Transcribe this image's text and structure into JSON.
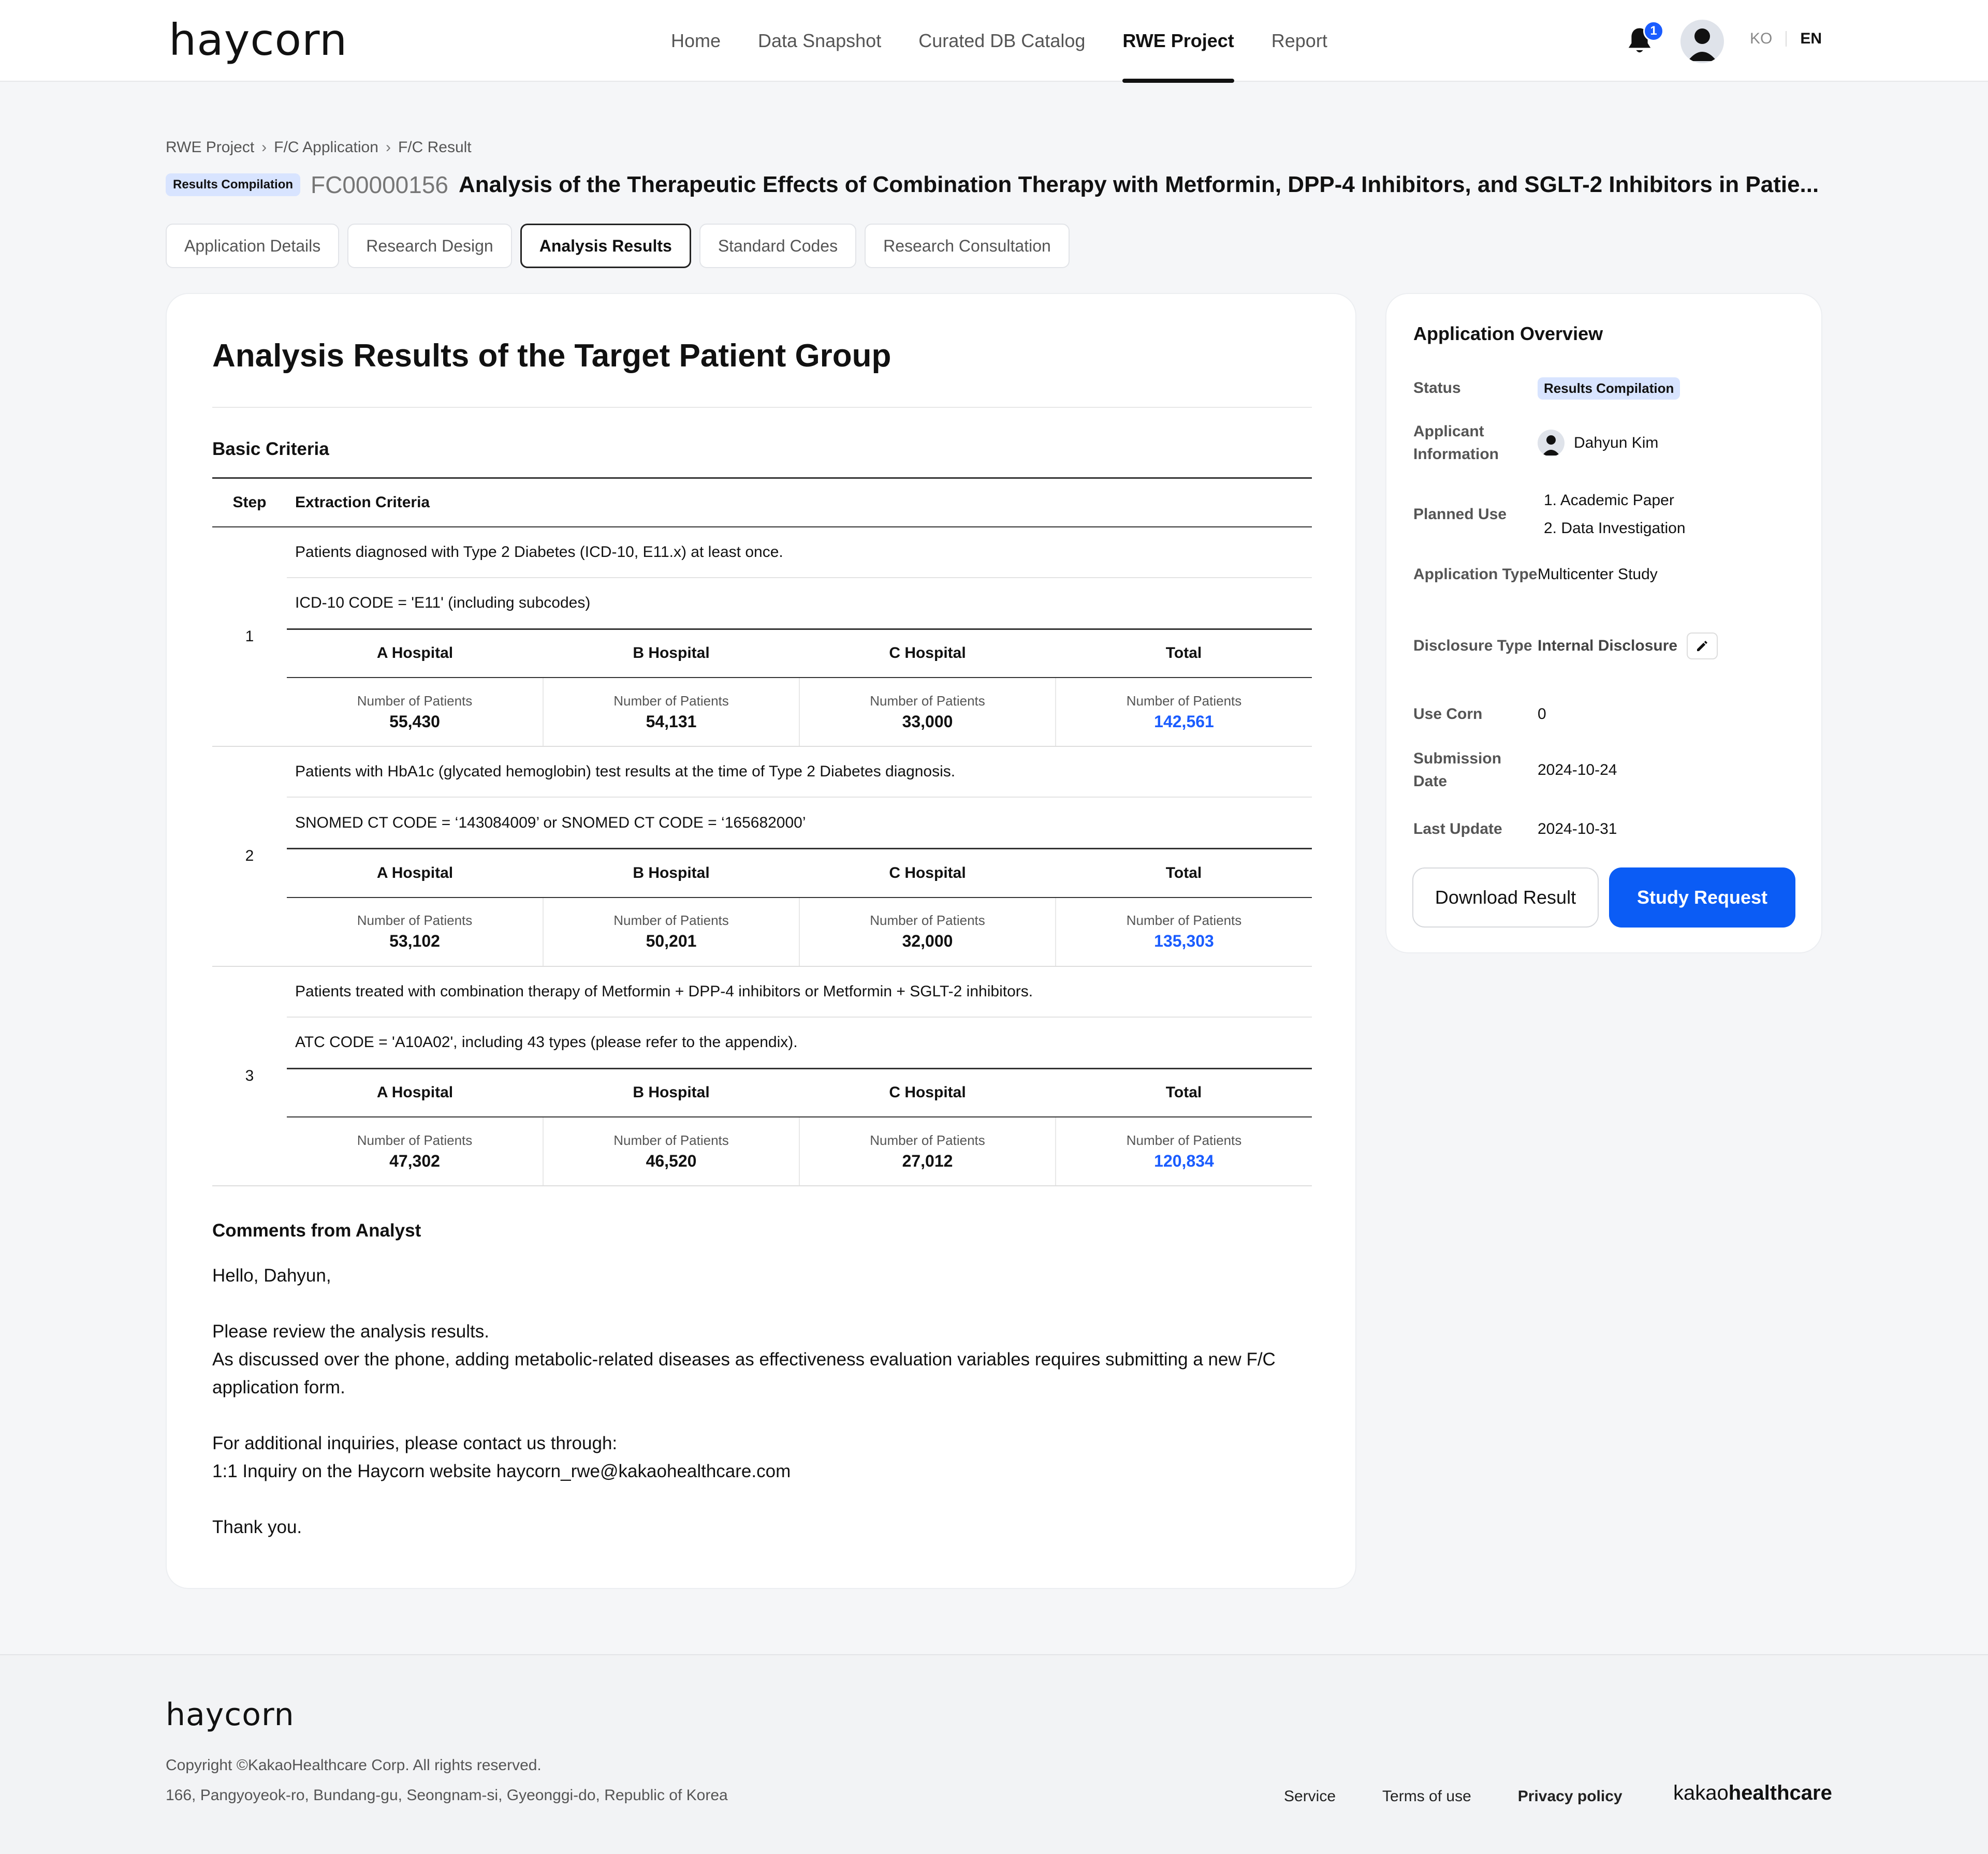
{
  "header": {
    "logo": "haycorn",
    "nav": [
      "Home",
      "Data Snapshot",
      "Curated DB Catalog",
      "RWE Project",
      "Report"
    ],
    "notification_count": "1",
    "lang_ko": "KO",
    "lang_en": "EN"
  },
  "breadcrumb": [
    "RWE Project",
    "F/C Application",
    "F/C Result"
  ],
  "project": {
    "status_badge": "Results Compilation",
    "id": "FC00000156",
    "title": "Analysis of the Therapeutic Effects of Combination Therapy with Metformin, DPP-4 Inhibitors, and SGLT-2 Inhibitors in Patie..."
  },
  "tabs": [
    "Application Details",
    "Research Design",
    "Analysis Results",
    "Standard Codes",
    "Research Consultation"
  ],
  "main": {
    "title": "Analysis Results of the Target Patient Group",
    "basic_criteria": "Basic Criteria",
    "col_step": "Step",
    "col_criteria": "Extraction Criteria",
    "hospitals": [
      "A Hospital",
      "B Hospital",
      "C Hospital",
      "Total"
    ],
    "patients_label": "Number of Patients",
    "steps": [
      {
        "step": "1",
        "criteria": "Patients diagnosed with Type 2 Diabetes (ICD-10, E11.x) at least once.",
        "code": "ICD-10 CODE = 'E11' (including subcodes)",
        "counts": [
          "55,430",
          "54,131",
          "33,000",
          "142,561"
        ]
      },
      {
        "step": "2",
        "criteria": "Patients with HbA1c (glycated hemoglobin) test results at the time of Type 2 Diabetes diagnosis.",
        "code": "SNOMED CT CODE = ‘143084009’ or SNOMED CT CODE = ‘165682000’",
        "counts": [
          "53,102",
          "50,201",
          "32,000",
          "135,303"
        ]
      },
      {
        "step": "3",
        "criteria": "Patients treated with combination therapy of Metformin + DPP-4 inhibitors or Metformin + SGLT-2 inhibitors.",
        "code": "ATC CODE = 'A10A02', including 43 types (please refer to the appendix).",
        "counts": [
          "47,302",
          "46,520",
          "27,012",
          "120,834"
        ]
      }
    ],
    "comments_title": "Comments from Analyst",
    "comments": {
      "greeting": "Hello, Dahyun,",
      "line1": "Please review the analysis results.",
      "line2": "As discussed over the phone, adding metabolic-related diseases as effectiveness evaluation variables requires submitting a new F/C application form.",
      "line3": "For additional inquiries, please contact us through:",
      "line4": "1:1 Inquiry on the Haycorn website haycorn_rwe@kakaohealthcare.com",
      "closing": "Thank you."
    }
  },
  "overview": {
    "title": "Application Overview",
    "status_label": "Status",
    "status": "Results Compilation",
    "applicant_label": "Applicant Information",
    "applicant": "Dahyun Kim",
    "planned_use_label": "Planned Use",
    "planned_use": [
      "1. Academic Paper",
      "2. Data Investigation"
    ],
    "app_type_label": "Application Type",
    "app_type": "Multicenter Study",
    "disclosure_label": "Disclosure Type",
    "disclosure": "Internal Disclosure",
    "use_corn_label": "Use Corn",
    "use_corn": "0",
    "submission_label": "Submission Date",
    "submission": "2024-10-24",
    "last_update_label": "Last Update",
    "last_update": "2024-10-31",
    "download_btn": "Download Result",
    "request_btn": "Study Request"
  },
  "footer": {
    "logo": "haycorn",
    "copyright": "Copyright ©KakaoHealthcare Corp. All rights reserved.",
    "address": "166, Pangyoyeok-ro, Bundang-gu, Seongnam-si, Gyeonggi-do, Republic of Korea",
    "links": [
      "Service",
      "Terms of use",
      "Privacy policy"
    ],
    "brand_light": "kakao",
    "brand_bold": "healthcare"
  },
  "colors": {
    "accent": "#0b5cf5",
    "badge_bg": "#d8e4ff",
    "total_blue": "#1a5cff"
  }
}
